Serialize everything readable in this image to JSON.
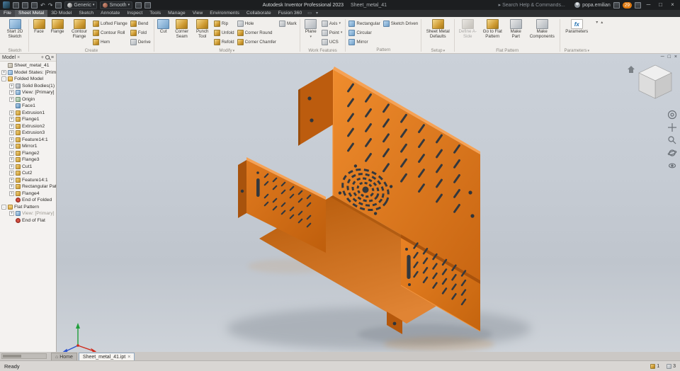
{
  "icons": {
    "caret": "▾",
    "undo": "↶",
    "redo": "↷",
    "search_arrow": "▸",
    "minimize": "─",
    "maximize": "□",
    "close": "×",
    "home": "⌂",
    "menu": "≡",
    "plus": "+",
    "panel": "▭",
    "collapse": "▴"
  },
  "titlebar": {
    "app_title": "Autodesk Inventor Professional 2023",
    "doc_title": "Sheet_metal_41",
    "material_value": "Generic",
    "appearance_value": "Smooth",
    "search_placeholder": "Search Help & Commands...",
    "user_name": "popa.emilian",
    "badge_count": "29"
  },
  "ribbon_tabs": [
    {
      "label": "File",
      "cls": "file"
    },
    {
      "label": "Sheet Metal",
      "cls": "active"
    },
    {
      "label": "3D Model"
    },
    {
      "label": "Sketch"
    },
    {
      "label": "Annotate"
    },
    {
      "label": "Inspect"
    },
    {
      "label": "Tools"
    },
    {
      "label": "Manage"
    },
    {
      "label": "View"
    },
    {
      "label": "Environments"
    },
    {
      "label": "Collaborate"
    },
    {
      "label": "Fusion 360"
    }
  ],
  "ribbon": {
    "sketch": {
      "group": "Sketch",
      "start2d": "Start 2D Sketch"
    },
    "create": {
      "group": "Create",
      "face": "Face",
      "flange": "Flange",
      "contour_flange": "Contour Flange",
      "lofted_flange": "Lofted Flange",
      "contour_roll": "Contour Roll",
      "hem": "Hem",
      "bend": "Bend",
      "fold": "Fold",
      "derive": "Derive"
    },
    "modify": {
      "group": "Modify",
      "cut": "Cut",
      "corner_seam": "Corner Seam",
      "punch_tool": "Punch Tool",
      "rip": "Rip",
      "unfold": "Unfold",
      "refold": "Refold",
      "hole": "Hole",
      "corner_round": "Corner Round",
      "corner_chamfer": "Corner Chamfer",
      "mark": "Mark"
    },
    "work_features": {
      "group": "Work Features",
      "plane": "Plane",
      "axis": "Axis",
      "point": "Point",
      "ucs": "UCS"
    },
    "pattern": {
      "group": "Pattern",
      "rectangular": "Rectangular",
      "circular": "Circular",
      "mirror": "Mirror",
      "sketch_driven": "Sketch Driven"
    },
    "setup": {
      "group": "Setup",
      "defaults": "Sheet Metal Defaults"
    },
    "flat_pattern": {
      "group": "Flat Pattern",
      "define_a_side": "Define A-Side",
      "go_to_flat": "Go to Flat Pattern",
      "make_part": "Make Part",
      "make_components": "Make Components"
    },
    "parameters": {
      "group": "Parameters",
      "parameters": "Parameters",
      "fx": "fx"
    }
  },
  "browser": {
    "title": "Model",
    "tree": [
      {
        "cls": "d0",
        "expander": "",
        "icon": "part",
        "label": "Sheet_metal_41"
      },
      {
        "cls": "d0",
        "expander": "+",
        "icon": "states",
        "label": "Model States: [Primary]"
      },
      {
        "cls": "d0",
        "expander": "-",
        "icon": "folder",
        "label": "Folded Model"
      },
      {
        "cls": "d1",
        "expander": "+",
        "icon": "solid",
        "label": "Solid Bodies(1)"
      },
      {
        "cls": "d1",
        "expander": "+",
        "icon": "view",
        "label": "View: [Primary]"
      },
      {
        "cls": "d1",
        "expander": "+",
        "icon": "origin",
        "label": "Origin"
      },
      {
        "cls": "d1",
        "expander": "",
        "icon": "face",
        "label": "Face1"
      },
      {
        "cls": "d1",
        "expander": "+",
        "icon": "feat",
        "label": "Extrusion1"
      },
      {
        "cls": "d1",
        "expander": "+",
        "icon": "feat",
        "label": "Flange1"
      },
      {
        "cls": "d1",
        "expander": "+",
        "icon": "feat",
        "label": "Extrusion2"
      },
      {
        "cls": "d1",
        "expander": "+",
        "icon": "feat",
        "label": "Extrusion3"
      },
      {
        "cls": "d1",
        "expander": "+",
        "icon": "feat",
        "label": "Feature14:1"
      },
      {
        "cls": "d1",
        "expander": "+",
        "icon": "feat",
        "label": "Mirror1"
      },
      {
        "cls": "d1",
        "expander": "+",
        "icon": "feat",
        "label": "Flange2"
      },
      {
        "cls": "d1",
        "expander": "+",
        "icon": "feat",
        "label": "Flange3"
      },
      {
        "cls": "d1",
        "expander": "+",
        "icon": "feat",
        "label": "Cut1"
      },
      {
        "cls": "d1",
        "expander": "+",
        "icon": "feat",
        "label": "Cut2"
      },
      {
        "cls": "d1",
        "expander": "+",
        "icon": "feat",
        "label": "Feature14:1"
      },
      {
        "cls": "d1",
        "expander": "+",
        "icon": "feat",
        "label": "Rectangular Pattern"
      },
      {
        "cls": "d1",
        "expander": "+",
        "icon": "feat",
        "label": "Flange4"
      },
      {
        "cls": "d1",
        "expander": "",
        "icon": "end",
        "label": "End of Folded"
      },
      {
        "cls": "d0",
        "expander": "-",
        "icon": "folder",
        "label": "Flat Pattern"
      },
      {
        "cls": "d1 dim",
        "expander": "+",
        "icon": "view",
        "label": "View: [Primary]"
      },
      {
        "cls": "d1",
        "expander": "",
        "icon": "end",
        "label": "End of Flat"
      }
    ]
  },
  "viewport": {
    "part_color": "#e0761c",
    "slot_color": "#33383e",
    "background_top": "#cbd1d9",
    "background_bottom": "#ced3d9"
  },
  "tabbar": {
    "home": "Home",
    "doc": "Sheet_metal_41.ipt"
  },
  "statusbar": {
    "ready": "Ready",
    "counter1": "1",
    "counter2": "3"
  }
}
